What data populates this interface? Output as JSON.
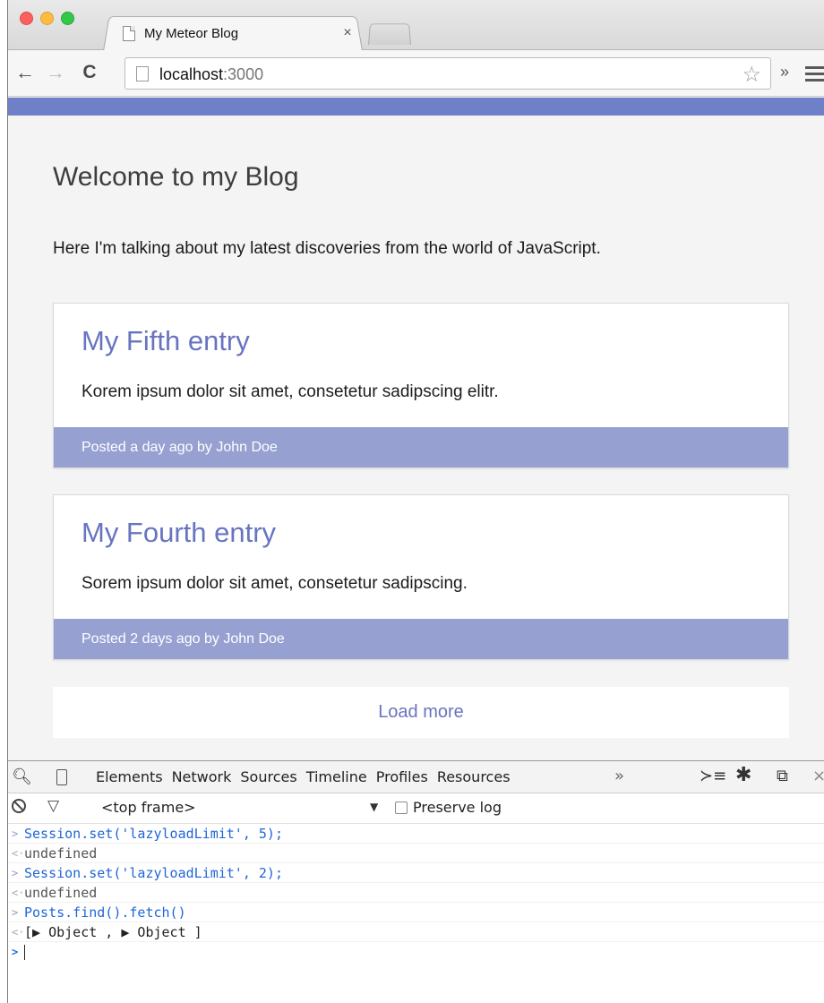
{
  "browser": {
    "tab_title": "My Meteor Blog",
    "tab_close": "×",
    "url_host": "localhost",
    "url_port": ":3000"
  },
  "page": {
    "accent_color": "#6f80c8",
    "title": "Welcome to my Blog",
    "subtitle": "Here I'm talking about my latest discoveries from the world of JavaScript.",
    "posts": [
      {
        "title": "My Fifth entry",
        "body": "Korem ipsum dolor sit amet, consetetur sadipscing elitr.",
        "footer": "Posted a day ago by John Doe"
      },
      {
        "title": "My Fourth entry",
        "body": "Sorem ipsum dolor sit amet, consetetur sadipscing.",
        "footer": "Posted 2 days ago by John Doe"
      }
    ],
    "load_more": "Load more"
  },
  "devtools": {
    "tabs": [
      "Elements",
      "Network",
      "Sources",
      "Timeline",
      "Profiles",
      "Resources"
    ],
    "more": "»",
    "frame": "<top frame>",
    "preserve_log": "Preserve log",
    "console": [
      {
        "type": "input",
        "text": "Session.set('lazyloadLimit', 5);"
      },
      {
        "type": "output",
        "text": "undefined"
      },
      {
        "type": "input",
        "text": "Session.set('lazyloadLimit', 2);"
      },
      {
        "type": "output",
        "text": "undefined"
      },
      {
        "type": "input",
        "text": "Posts.find().fetch()"
      },
      {
        "type": "output",
        "text": "[▶ Object , ▶ Object ]"
      }
    ]
  }
}
